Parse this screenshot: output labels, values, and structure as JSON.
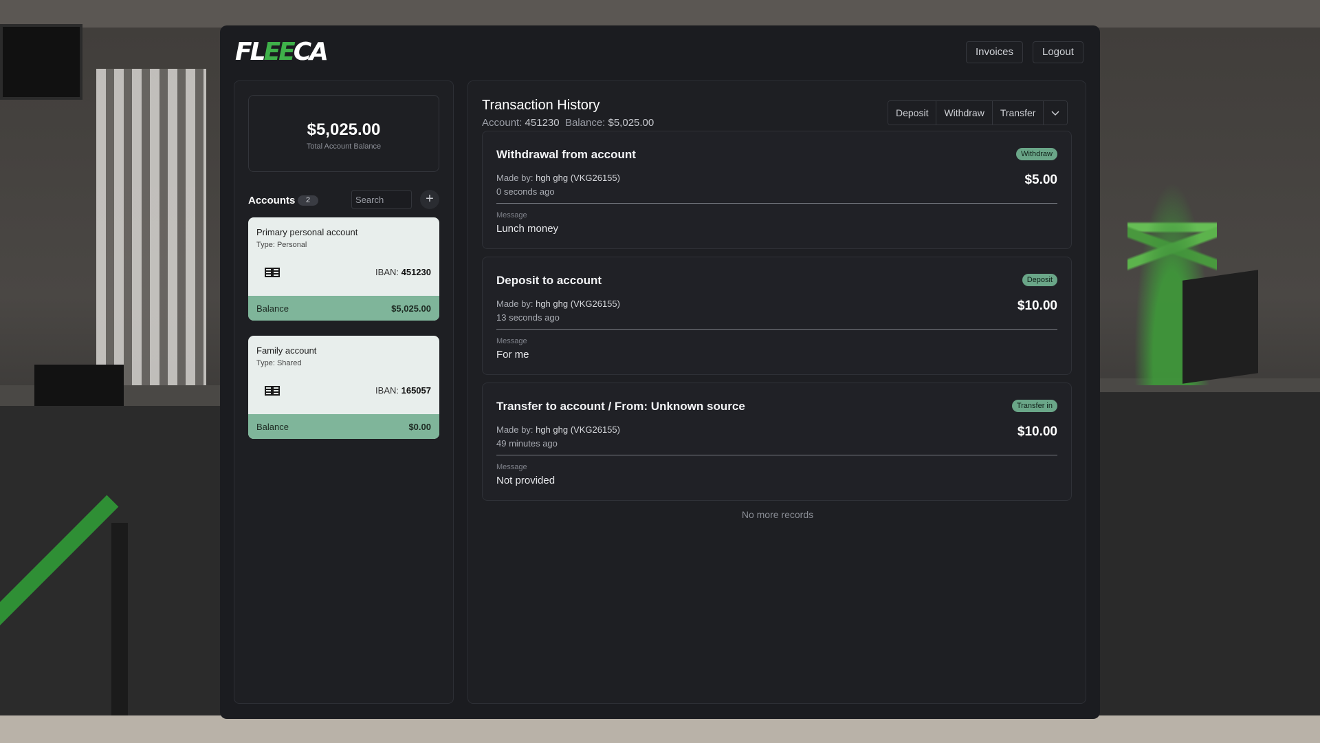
{
  "brand": {
    "logo_white_1": "FL",
    "logo_green": "EE",
    "logo_white_2": "CA"
  },
  "header": {
    "invoices_label": "Invoices",
    "logout_label": "Logout"
  },
  "summary": {
    "total_balance": "$5,025.00",
    "total_label": "Total Account Balance"
  },
  "accounts": {
    "title": "Accounts",
    "count": "2",
    "search_placeholder": "Search",
    "add_label": "+",
    "items": [
      {
        "name": "Primary personal account",
        "type": "Type: Personal",
        "iban_label": "IBAN: ",
        "iban": "451230",
        "balance_label": "Balance",
        "balance": "$5,025.00"
      },
      {
        "name": "Family account",
        "type": "Type: Shared",
        "iban_label": "IBAN: ",
        "iban": "165057",
        "balance_label": "Balance",
        "balance": "$0.00"
      }
    ]
  },
  "history": {
    "title": "Transaction History",
    "account_label": "Account: ",
    "account": "451230",
    "balance_label": "Balance: ",
    "balance": "$5,025.00",
    "actions": {
      "deposit": "Deposit",
      "withdraw": "Withdraw",
      "transfer": "Transfer"
    },
    "made_by_label": "Made by: ",
    "message_label": "Message",
    "transactions": [
      {
        "title": "Withdrawal from account",
        "badge": "Withdraw",
        "made_by": "hgh ghg (VKG26155)",
        "time": "0 seconds ago",
        "amount": "$5.00",
        "message": "Lunch money"
      },
      {
        "title": "Deposit to account",
        "badge": "Deposit",
        "made_by": "hgh ghg (VKG26155)",
        "time": "13 seconds ago",
        "amount": "$10.00",
        "message": "For me"
      },
      {
        "title": "Transfer to account / From: Unknown source",
        "badge": "Transfer in",
        "made_by": "hgh ghg (VKG26155)",
        "time": "49 minutes ago",
        "amount": "$10.00",
        "message": "Not provided"
      }
    ],
    "end_text": "No more records"
  },
  "colors": {
    "accent_green": "#3fb14a",
    "badge_green": "#6aa688",
    "card_footer": "#7fb59a",
    "window_bg": "#1b1c20"
  },
  "icons": {
    "card_chip": "card-chip-icon",
    "dropdown": "chevron-down-icon",
    "add": "plus-icon"
  }
}
